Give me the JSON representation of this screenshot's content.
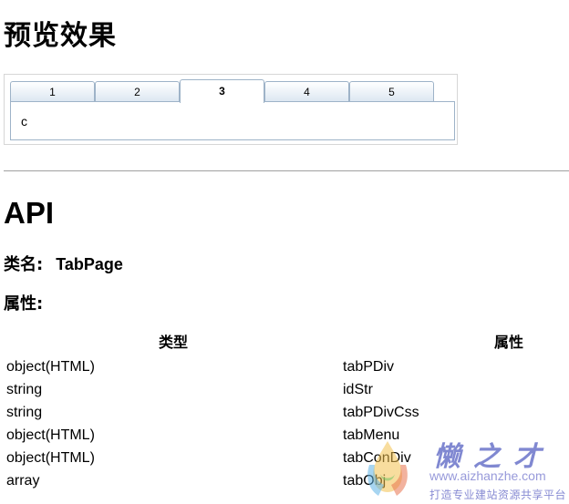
{
  "preview": {
    "heading": "预览效果",
    "tabs": [
      {
        "label": "1",
        "active": false
      },
      {
        "label": "2",
        "active": false
      },
      {
        "label": "3",
        "active": true
      },
      {
        "label": "4",
        "active": false
      },
      {
        "label": "5",
        "active": false
      }
    ],
    "content": "c"
  },
  "api": {
    "heading": "API",
    "class_label": "类名:",
    "class_value": "TabPage",
    "attributes_label": "属性:",
    "table": {
      "headers": [
        "类型",
        "属性"
      ],
      "rows": [
        [
          "object(HTML)",
          "tabPDiv"
        ],
        [
          "string",
          "idStr"
        ],
        [
          "string",
          "tabPDivCss"
        ],
        [
          "object(HTML)",
          "tabMenu"
        ],
        [
          "object(HTML)",
          "tabConDiv"
        ],
        [
          "array",
          "tabObj"
        ]
      ]
    }
  },
  "watermark": {
    "brand": "懒之才",
    "url": "www.aizhanzhe.com",
    "slogan": "打造专业建站资源共享平台"
  },
  "colors": {
    "tab_border": "#9eb3c8",
    "watermark": "#6b74c9"
  }
}
